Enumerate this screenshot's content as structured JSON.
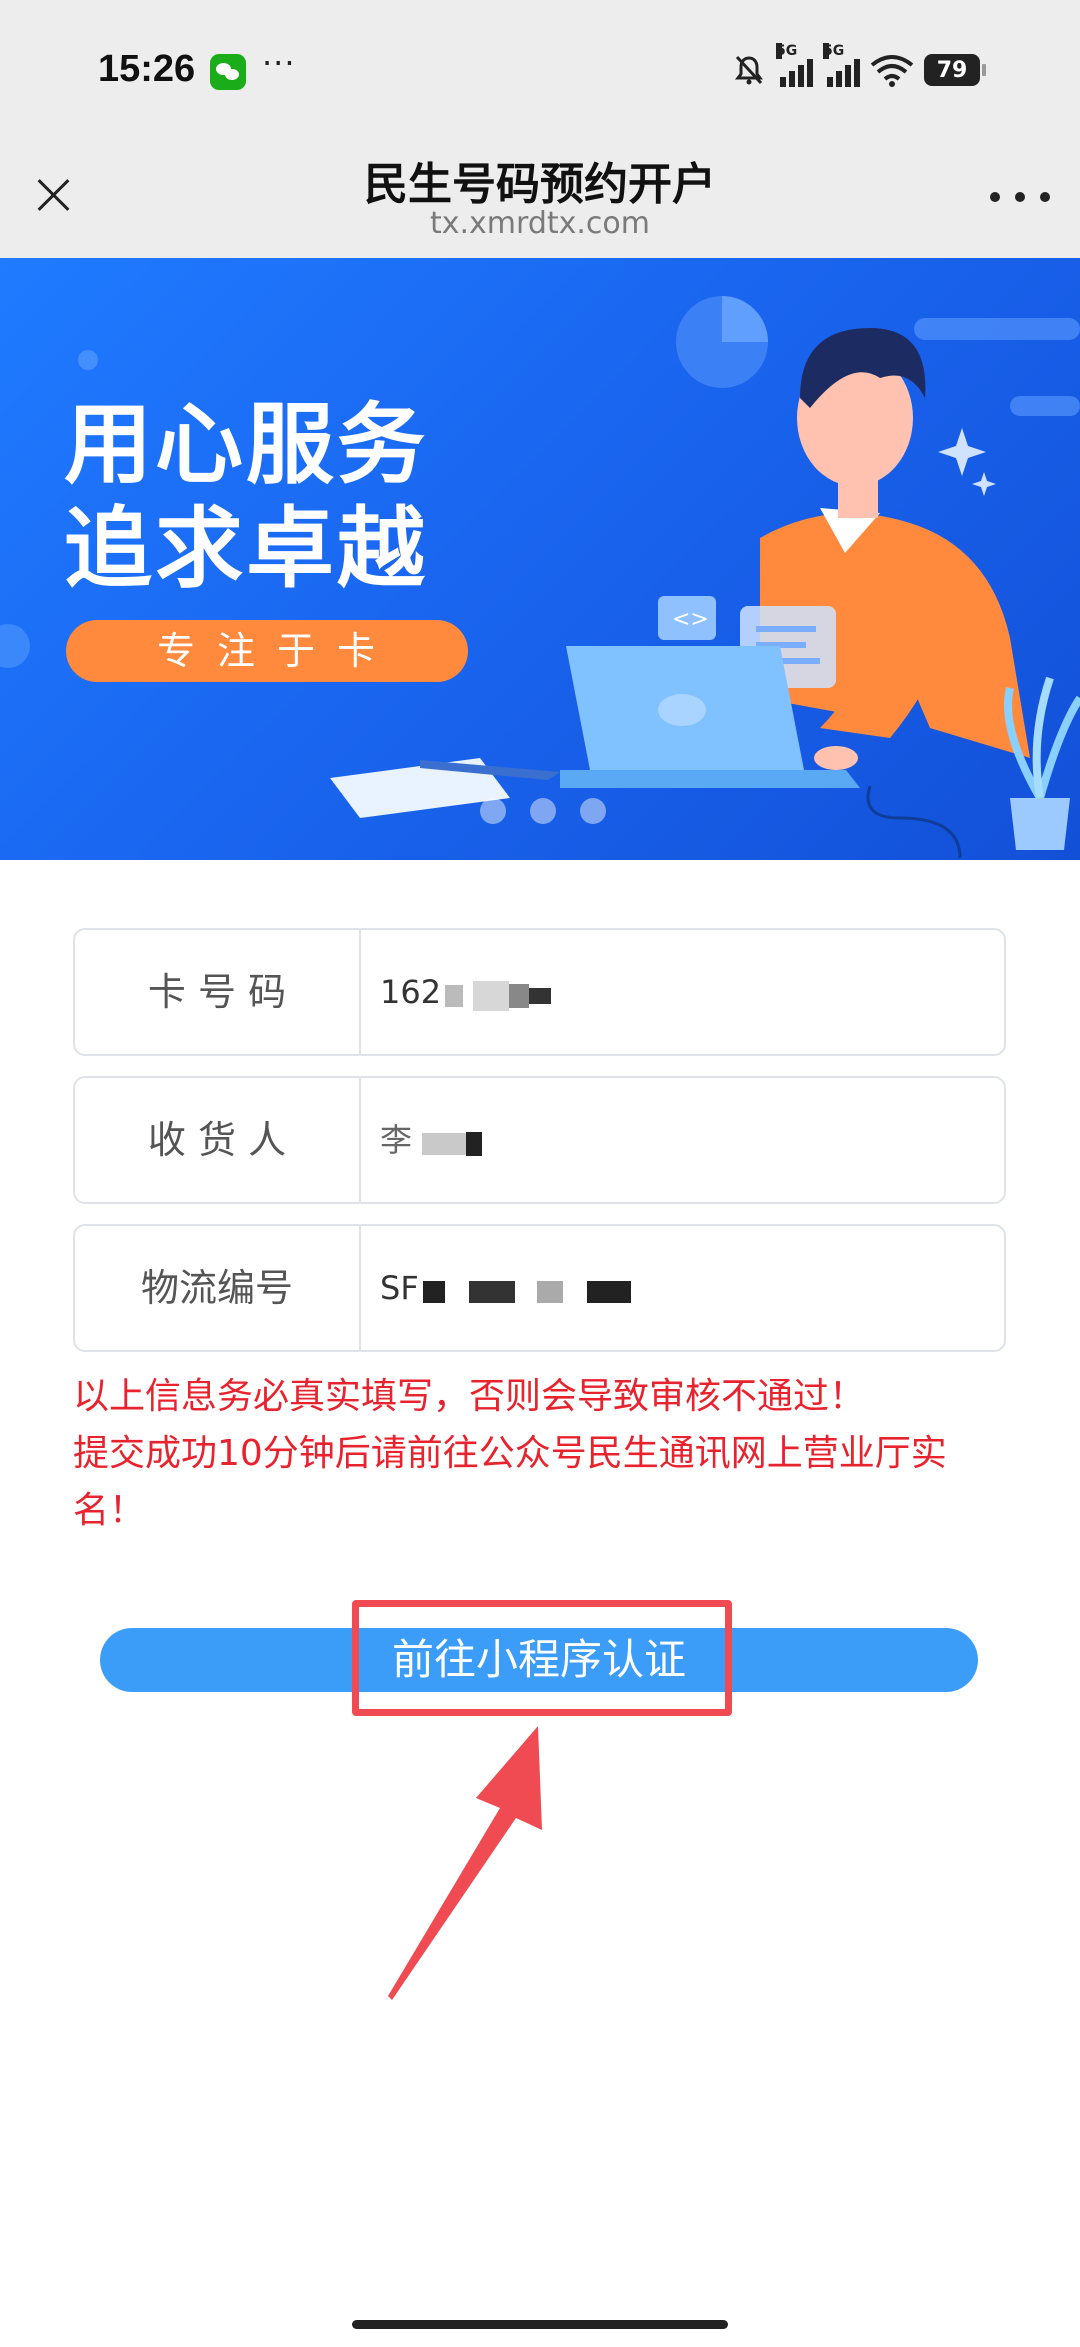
{
  "status_bar": {
    "time": "15:26",
    "more": "···",
    "signal1_label": "5G",
    "signal2_label": "5G",
    "battery": "79"
  },
  "nav": {
    "title": "民生号码预约开户",
    "url": "tx.xmrdtx.com"
  },
  "banner": {
    "headline_line1": "用心服务",
    "headline_line2": "追求卓越",
    "pill": "专注于卡",
    "slide_count": 3
  },
  "form": {
    "rows": [
      {
        "label": "卡 号 码",
        "value": "162"
      },
      {
        "label": "收 货 人",
        "value": "李"
      },
      {
        "label": "物流编号",
        "value": "SF"
      }
    ]
  },
  "notice": {
    "line1": "以上信息务必真实填写，否则会导致审核不通过！",
    "line2": "提交成功10分钟后请前往公众号民生通讯网上营业厅实名！"
  },
  "cta": {
    "label": "前往小程序认证"
  },
  "colors": {
    "accent_blue": "#3b9df8",
    "warning_red": "#e8232e",
    "highlight_red": "#f04b53",
    "banner_blue": "#1a66f0",
    "pill_orange": "#ff8a3d"
  }
}
